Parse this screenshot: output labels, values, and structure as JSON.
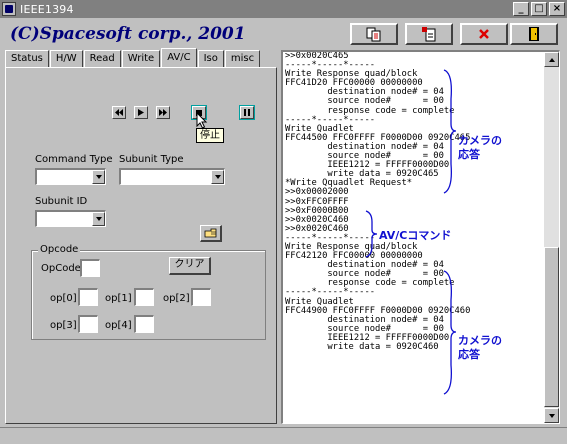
{
  "window": {
    "title": "IEEE1394",
    "controls": [
      "_",
      "□",
      "×"
    ]
  },
  "brand": "(C)Spacesoft corp., 2001",
  "toolbar": [
    "copy-icon",
    "paste-icon",
    "stop-x-icon",
    "exit-door-icon"
  ],
  "tabs": [
    {
      "label": "Status"
    },
    {
      "label": "H/W"
    },
    {
      "label": "Read"
    },
    {
      "label": "Write"
    },
    {
      "label": "AV/C",
      "active": true
    },
    {
      "label": "Iso"
    },
    {
      "label": "misc"
    }
  ],
  "transport": {
    "buttons": [
      "rewind-icon",
      "play-icon",
      "fast-forward-icon",
      "stop-icon",
      "pause-icon"
    ],
    "tooltip": "停止"
  },
  "form": {
    "command_type_label": "Command Type",
    "subunit_type_label": "Subunit Type",
    "subunit_id_label": "Subunit ID",
    "command_type_value": "",
    "subunit_type_value": "",
    "subunit_id_value": ""
  },
  "opcode": {
    "group_label": "Opcode",
    "opcode_label": "OpCode",
    "clear_label": "クリア",
    "op_labels": [
      "op[0]",
      "op[1]",
      "op[2]",
      "op[3]",
      "op[4]"
    ]
  },
  "log_lines": [
    ">>0x0020C465",
    "-----*-----*-----",
    "Write Response quad/block",
    "FFC41D20 FFC00000 00000000",
    "        destination node# = 04",
    "        source node#      = 00",
    "        response code = complete",
    "-----*-----*-----",
    "Write Quadlet",
    "FFC44500 FFC0FFFF F0000D00 0920C465",
    "        destination node# = 04",
    "        source node#      = 00",
    "        IEEE1212 = FFFFF0000D00",
    "        write data = 0920C465",
    "*Write Qquadlet Request*",
    ">>0x00002000",
    ">>0xFFC0FFFF",
    ">>0xF0000B00",
    ">>0x0020C460",
    ">>0x0020C460",
    "-----*-----*-----",
    "Write Response quad/block",
    "FFC42120 FFC00000 00000000",
    "        destination node# = 04",
    "        source node#      = 00",
    "        response code = complete",
    "-----*-----*-----",
    "Write Quadlet",
    "FFC44900 FFC0FFFF F0000D00 0920C460",
    "        destination node# = 04",
    "        source node#      = 00",
    "        IEEE1212 = FFFFF0000D00",
    "        write data = 0920C460"
  ],
  "annotations": {
    "camera_response_1": [
      "カメラの",
      "応答"
    ],
    "avc_command": "AV/Cコマンド",
    "camera_response_2": [
      "カメラの",
      "応答"
    ]
  },
  "colors": {
    "annotation": "#1010d0",
    "brand": "#00007a"
  }
}
